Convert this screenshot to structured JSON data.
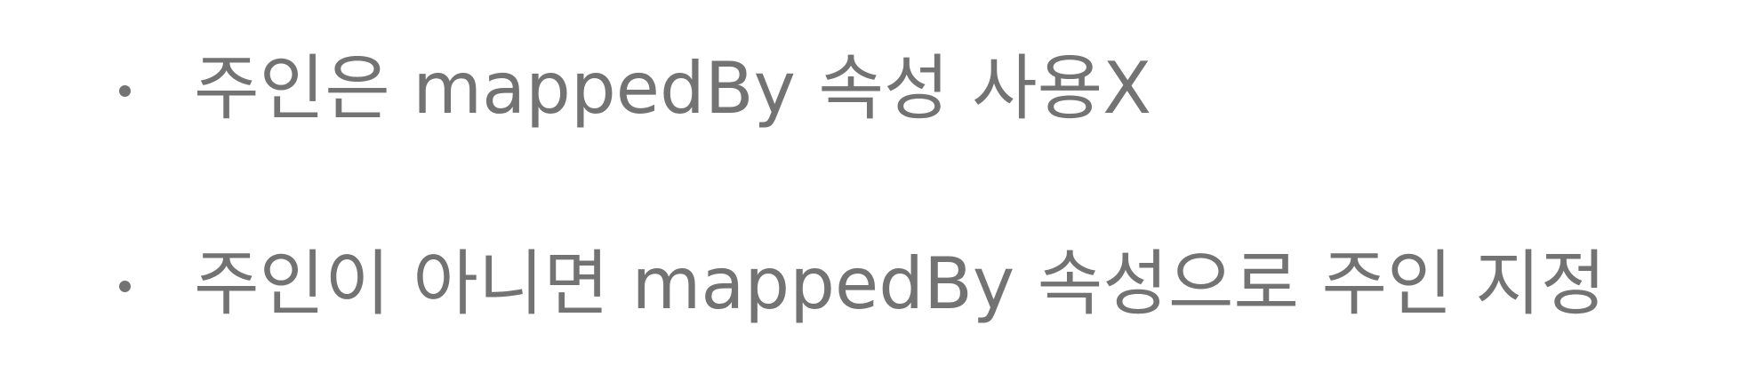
{
  "bullets": [
    {
      "text": "주인은 mappedBy 속성 사용X"
    },
    {
      "text": "주인이 아니면 mappedBy 속성으로 주인 지정"
    }
  ],
  "colors": {
    "text": "#737373",
    "background": "#ffffff"
  }
}
